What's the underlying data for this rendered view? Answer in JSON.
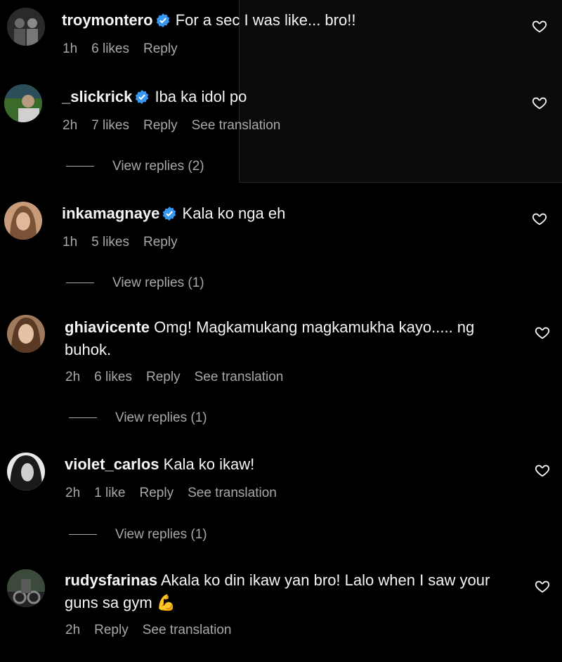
{
  "comments": [
    {
      "username": "troymontero",
      "verified": true,
      "text": "For a sec I was like... bro!!",
      "time": "1h",
      "likes": "6 likes",
      "reply": "Reply",
      "translation": ""
    },
    {
      "username": "_slickrick",
      "verified": true,
      "text": "Iba ka idol po",
      "time": "2h",
      "likes": "7 likes",
      "reply": "Reply",
      "translation": "See translation",
      "view_replies": "View replies (2)"
    },
    {
      "username": "inkamagnaye",
      "verified": true,
      "text": "Kala ko nga eh",
      "time": "1h",
      "likes": "5 likes",
      "reply": "Reply",
      "translation": "",
      "view_replies": "View replies (1)"
    },
    {
      "username": "ghiavicente",
      "verified": false,
      "text": "Omg! Magkamukang magkamukha kayo..... ng buhok.",
      "time": "2h",
      "likes": "6 likes",
      "reply": "Reply",
      "translation": "See translation",
      "view_replies": "View replies (1)"
    },
    {
      "username": "violet_carlos",
      "verified": false,
      "text": "Kala ko ikaw!",
      "time": "2h",
      "likes": "1 like",
      "reply": "Reply",
      "translation": "See translation",
      "view_replies": "View replies (1)"
    },
    {
      "username": "rudysfarinas",
      "verified": false,
      "text": "Akala ko din ikaw yan bro! Lalo when I saw your guns sa gym 💪",
      "time": "2h",
      "likes": "",
      "reply": "Reply",
      "translation": "See translation"
    }
  ],
  "colors": {
    "background": "#000000",
    "text": "#f5f5f5",
    "meta": "#a8a8a8",
    "verified": "#3897f0"
  },
  "icons": {
    "like": "heart-outline-icon",
    "verified": "verified-badge-icon"
  }
}
